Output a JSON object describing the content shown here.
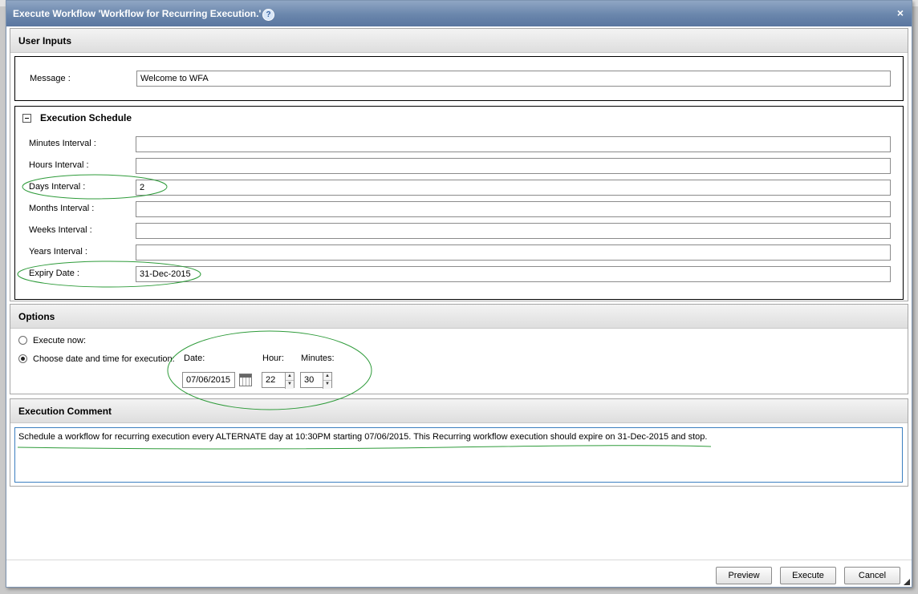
{
  "dialog": {
    "title": "Execute Workflow 'Workflow for Recurring Execution.'",
    "help_icon": "help-icon",
    "close_icon": "close-icon",
    "close_glyph": "×",
    "help_glyph": "?"
  },
  "user_inputs": {
    "heading": "User Inputs",
    "message_label": "Message :",
    "message_value": "Welcome to WFA"
  },
  "schedule": {
    "heading": "Execution Schedule",
    "fields": [
      {
        "label": "Minutes Interval :",
        "value": ""
      },
      {
        "label": "Hours Interval :",
        "value": ""
      },
      {
        "label": "Days Interval :",
        "value": "2"
      },
      {
        "label": "Months Interval :",
        "value": ""
      },
      {
        "label": "Weeks Interval :",
        "value": ""
      },
      {
        "label": "Years Interval :",
        "value": ""
      },
      {
        "label": "Expiry Date :",
        "value": "31-Dec-2015"
      }
    ]
  },
  "options": {
    "heading": "Options",
    "execute_now_label": "Execute now:",
    "choose_label": "Choose date and time for execution:",
    "selected": "choose",
    "date_label": "Date:",
    "date_value": "07/06/2015",
    "hour_label": "Hour:",
    "hour_value": "22",
    "minutes_label": "Minutes:",
    "minutes_value": "30"
  },
  "comment": {
    "heading": "Execution Comment",
    "text": "Schedule a workflow for recurring execution every ALTERNATE day at 10:30PM starting 07/06/2015. This Recurring workflow execution should expire on 31-Dec-2015 and stop."
  },
  "buttons": {
    "preview": "Preview",
    "execute": "Execute",
    "cancel": "Cancel"
  },
  "colors": {
    "title_bar": "#6a86ac",
    "annotation": "#2e9b3a",
    "focus_border": "#3c7fc0"
  }
}
